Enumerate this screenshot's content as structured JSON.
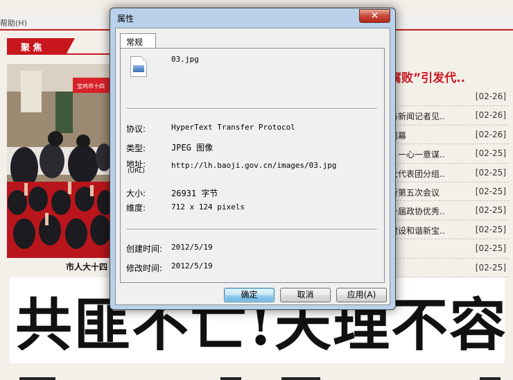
{
  "browser": {
    "menu_help": "帮助(H)"
  },
  "page": {
    "section_label": "聚 焦",
    "photo_caption": "市人大十四",
    "photo_sign_text": "宝鸡市十四",
    "headline": "腐败”引发代..",
    "news": [
      {
        "title": "",
        "date": "[02-26]"
      },
      {
        "title": "与新闻记者见..",
        "date": "[02-26]"
      },
      {
        "title": "闭幕",
        "date": "[02-26]"
      },
      {
        "title": "：一心一意谋..",
        "date": "[02-25]"
      },
      {
        "title": "大代表团分组..",
        "date": "[02-25]"
      },
      {
        "title": "行第五次会议",
        "date": "[02-25]"
      },
      {
        "title": "十届政协优秀..",
        "date": "[02-25]"
      },
      {
        "title": "建设和谐新宝..",
        "date": "[02-25]"
      },
      {
        "title": "",
        "date": "[02-25]"
      },
      {
        "title": "",
        "date": "[02-25]"
      }
    ],
    "banner_text": "共匪不亡!天理不容!"
  },
  "dialog": {
    "title": "属性",
    "close_label": "✕",
    "tab_general": "常规",
    "file_name": "03.jpg",
    "protocol_label": "协议:",
    "protocol_value": "HyperText Transfer Protocol",
    "type_label": "类型:",
    "type_value": "JPEG 图像",
    "address_label": "地址:",
    "address_sub": "(URL)",
    "address_value": "http://lh.baoji.gov.cn/images/03.jpg",
    "size_label": "大小:",
    "size_value": "26931 字节",
    "dimensions_label": "维度:",
    "dimensions_value": "712  x  124  pixels",
    "created_label": "创建时间:",
    "created_value": "2012/5/19",
    "modified_label": "修改时间:",
    "modified_value": "2012/5/19",
    "ok_label": "确定",
    "cancel_label": "取消",
    "apply_label": "应用(A)"
  },
  "colors": {
    "accent_red": "#c8161d",
    "headline_red": "#d0141c",
    "dialog_frame": "#b9d1ea"
  }
}
